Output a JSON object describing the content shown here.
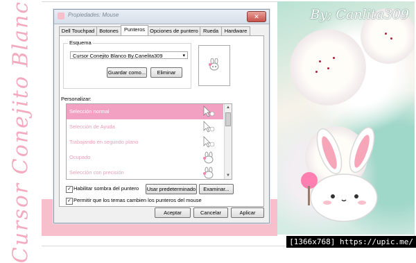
{
  "background": {
    "vertical_title": "Cursor Conejito Blanco",
    "author_text": "By; Canlita309",
    "accent_pink": "#f2a1c3",
    "url_bar": "[1366x768] https://upic.me/"
  },
  "dialog": {
    "title": "Propiedades: Mouse",
    "close_label": "✕",
    "tabs": [
      {
        "label": "Dell Touchpad"
      },
      {
        "label": "Botones"
      },
      {
        "label": "Punteros",
        "active": true
      },
      {
        "label": "Opciones de puntero"
      },
      {
        "label": "Rueda"
      },
      {
        "label": "Hardware"
      }
    ],
    "scheme": {
      "label": "Esquema",
      "value": "Cursor Conejito Blanco By.Canelita309",
      "save_as_label": "Guardar como...",
      "delete_label": "Eliminar"
    },
    "customize_label": "Personalizar:",
    "cursor_list": [
      {
        "label": "Selección normal",
        "selected": true
      },
      {
        "label": "Selección de Ayuda"
      },
      {
        "label": "Trabajando en segundo plano"
      },
      {
        "label": "Ocupado"
      },
      {
        "label": "Selección con precisión"
      }
    ],
    "shadow_checkbox": {
      "label": "Habilitar sombra del puntero",
      "checked": true
    },
    "use_default_label": "Usar predeterminado",
    "browse_label": "Examinar...",
    "themes_checkbox": {
      "label": "Permitir que los temas cambien los punteros del mouse",
      "checked": true
    },
    "ok_label": "Aceptar",
    "cancel_label": "Cancelar",
    "apply_label": "Aplicar"
  }
}
